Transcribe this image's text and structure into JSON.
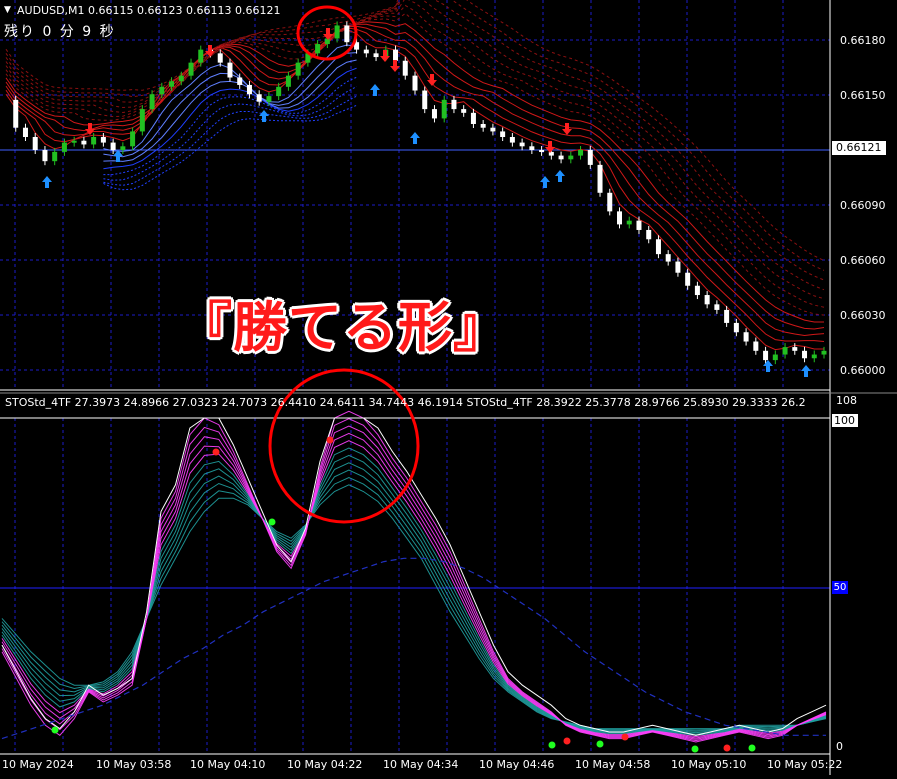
{
  "header": {
    "symbol_info": "AUDUSD,M1  0.66115 0.66123 0.66113 0.66121",
    "countdown": "残り 0 分 9 秒"
  },
  "overlay_text": "『勝てる形』",
  "indicator_header": "STOStd_4TF 27.3973 24.8966 27.0323 24.7073 26.4410 24.6411 34.7443 46.1914  STOStd_4TF 28.3922 25.3778 28.9766 25.8930 29.3333 26.2",
  "colors": {
    "background": "#000000",
    "grid": "#1c1cc8",
    "bull_candle": "#22c022",
    "bear_candle": "#ffffff",
    "buy_arrow": "#1e90ff",
    "sell_arrow": "#ff2020",
    "ribbon_red": "#c41010",
    "ribbon_blue": "#2040ff",
    "stoch_magenta": "#ff40ff",
    "stoch_cyan": "#20a0a0",
    "highlight_circle": "#ff0000"
  },
  "chart_data": [
    {
      "type": "candlestick",
      "title": "AUDUSD,M1",
      "y_ticks": [
        "0.66180",
        "0.66150",
        "0.66120",
        "0.66090",
        "0.66060",
        "0.66030",
        "0.66000"
      ],
      "current_price": "0.66121",
      "ylim": [
        0.6599,
        0.66196
      ],
      "x_ticks": [
        "10 May 2024",
        "10 May 03:58",
        "10 May 04:10",
        "10 May 04:22",
        "10 May 04:34",
        "10 May 04:46",
        "10 May 04:58",
        "10 May 05:10",
        "10 May 05:22"
      ],
      "close_path": [
        0.66145,
        0.6613,
        0.66125,
        0.66118,
        0.66112,
        0.66117,
        0.66122,
        0.66123,
        0.66121,
        0.66125,
        0.66122,
        0.66118,
        0.6612,
        0.66128,
        0.6614,
        0.66148,
        0.66152,
        0.66155,
        0.66158,
        0.66165,
        0.66172,
        0.6617,
        0.66165,
        0.66157,
        0.66153,
        0.66148,
        0.66144,
        0.66147,
        0.66152,
        0.66158,
        0.66165,
        0.6617,
        0.66175,
        0.66178,
        0.66185,
        0.66176,
        0.66172,
        0.6617,
        0.66168,
        0.66172,
        0.66166,
        0.66158,
        0.6615,
        0.6614,
        0.66135,
        0.66145,
        0.6614,
        0.66138,
        0.66132,
        0.6613,
        0.66128,
        0.66125,
        0.66122,
        0.6612,
        0.66118,
        0.66117,
        0.66115,
        0.66113,
        0.66115,
        0.66118,
        0.6611,
        0.66095,
        0.66085,
        0.66078,
        0.6608,
        0.66075,
        0.6607,
        0.66062,
        0.66058,
        0.66052,
        0.66045,
        0.6604,
        0.66035,
        0.66032,
        0.66025,
        0.6602,
        0.66015,
        0.6601,
        0.66005,
        0.66008,
        0.66012,
        0.6601,
        0.66006,
        0.66008,
        0.6601
      ]
    },
    {
      "type": "line",
      "title": "STOStd_4TF",
      "y_ticks": [
        "108",
        "100",
        "50",
        "0"
      ],
      "ylim": [
        0,
        108
      ],
      "series": [
        {
          "name": "STOStd_4TF",
          "values": [
            30,
            22,
            14,
            8,
            5,
            10,
            18,
            15,
            17,
            20,
            40,
            70,
            78,
            95,
            100,
            98,
            90,
            80,
            70,
            60,
            55,
            65,
            85,
            100,
            102,
            100,
            95,
            88,
            82,
            75,
            68,
            60,
            50,
            40,
            30,
            22,
            18,
            15,
            12,
            8,
            6,
            5,
            4,
            4,
            5,
            6,
            5,
            4,
            3,
            4,
            5,
            6,
            5,
            4,
            5,
            8,
            10,
            12
          ]
        },
        {
          "name": "STOStd_4TF",
          "values": [
            40,
            35,
            30,
            26,
            22,
            20,
            20,
            21,
            24,
            30,
            40,
            50,
            58,
            66,
            72,
            76,
            76,
            74,
            70,
            66,
            64,
            68,
            74,
            78,
            80,
            78,
            75,
            70,
            64,
            58,
            50,
            42,
            35,
            28,
            22,
            18,
            15,
            12,
            10,
            9,
            8,
            7,
            7,
            7,
            7,
            7,
            7,
            7,
            7,
            7,
            7,
            8,
            8,
            8,
            8,
            8,
            9,
            10
          ]
        },
        {
          "name": "STOStd_4TF",
          "values": [
            4,
            6,
            8,
            10,
            12,
            14,
            17,
            20,
            24,
            28,
            31,
            35,
            38,
            42,
            45,
            48,
            51,
            53,
            55,
            57,
            58,
            58,
            57,
            55,
            52,
            48,
            44,
            40,
            35,
            30,
            26,
            22,
            18,
            15,
            12,
            10,
            8,
            7,
            6,
            5,
            5,
            5
          ]
        }
      ]
    }
  ]
}
